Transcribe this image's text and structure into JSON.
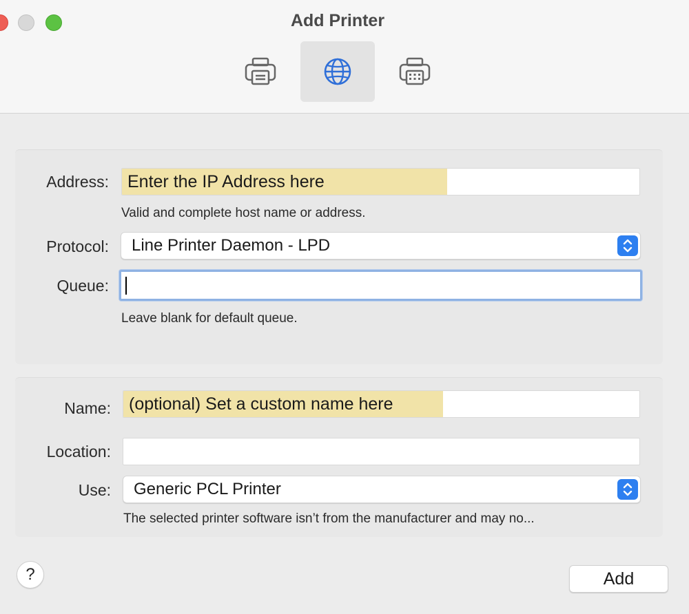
{
  "window": {
    "title": "Add Printer"
  },
  "toolbar": {
    "items": [
      {
        "icon": "default-printer-icon",
        "selected": false
      },
      {
        "icon": "ip-globe-icon",
        "selected": true
      },
      {
        "icon": "windows-printer-icon",
        "selected": false
      }
    ]
  },
  "ip_section": {
    "address": {
      "label": "Address:",
      "value": "Enter the IP Address here",
      "hint": "Valid and complete host name or address."
    },
    "protocol": {
      "label": "Protocol:",
      "selected": "Line Printer Daemon - LPD"
    },
    "queue": {
      "label": "Queue:",
      "value": "",
      "hint": "Leave blank for default queue."
    }
  },
  "details_section": {
    "name": {
      "label": "Name:",
      "value": "(optional) Set a custom name here"
    },
    "location": {
      "label": "Location:",
      "value": ""
    },
    "use": {
      "label": "Use:",
      "selected": "Generic PCL Printer",
      "hint": "The selected printer software isn’t from the manufacturer and may no..."
    }
  },
  "footer": {
    "help_label": "?",
    "add_label": "Add"
  },
  "colors": {
    "accent": "#2d7ff0",
    "highlight": "#f1e3a8",
    "focus_ring": "#8fb2e3"
  }
}
